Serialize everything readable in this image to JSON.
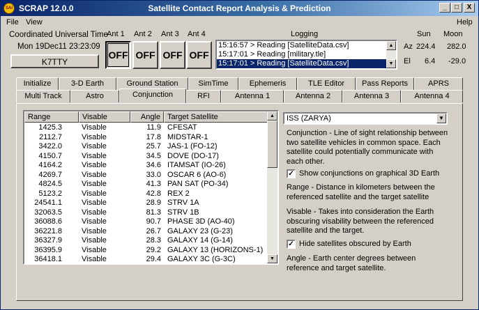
{
  "window": {
    "app_name": "SCRAP  12.0.0",
    "title": "Satellite Contact Report Analysis & Prediction",
    "logo_text": "SAI",
    "minimize": "_",
    "maximize": "□",
    "close": "X"
  },
  "menu": {
    "file": "File",
    "view": "View",
    "help": "Help"
  },
  "clock": {
    "label": "Coordinated Universal Time",
    "value": "Mon 19Dec11 23:23:09",
    "callsign": "K7TTY"
  },
  "antennas": [
    {
      "label": "Ant 1",
      "state": "OFF"
    },
    {
      "label": "Ant 2",
      "state": "OFF"
    },
    {
      "label": "Ant 3",
      "state": "OFF"
    },
    {
      "label": "Ant 4",
      "state": "OFF"
    }
  ],
  "logging": {
    "label": "Logging",
    "lines": [
      "15:16:57 > Reading [SatelliteData.csv]",
      "15:17:01 > Reading [military.tle]",
      "15:17:01 > Reading [SatelliteData.csv]"
    ]
  },
  "sunmoon": {
    "sun_label": "Sun",
    "moon_label": "Moon",
    "az_label": "Az",
    "el_label": "El",
    "sun_az": "224.4",
    "moon_az": "282.0",
    "sun_el": "6.4",
    "moon_el": "-29.0"
  },
  "tabs_row1": [
    "Initialize",
    "3-D Earth",
    "Ground Station",
    "SimTime",
    "Ephemeris",
    "TLE Editor",
    "Pass Reports",
    "APRS"
  ],
  "tabs_row2": [
    "Multi Track",
    "Astro",
    "Conjunction",
    "RFI",
    "Antenna 1",
    "Antenna 2",
    "Antenna 3",
    "Antenna 4"
  ],
  "table": {
    "headers": [
      "Range",
      "Visable",
      "Angle",
      "Target Satellite"
    ],
    "rows": [
      [
        "1425.3",
        "Visable",
        "11.9",
        "CFESAT"
      ],
      [
        "2112.7",
        "Visable",
        "17.8",
        "MIDSTAR-1"
      ],
      [
        "3422.0",
        "Visable",
        "25.7",
        "JAS-1 (FO-12)"
      ],
      [
        "4150.7",
        "Visable",
        "34.5",
        "DOVE (DO-17)"
      ],
      [
        "4164.2",
        "Visable",
        "34.6",
        "ITAMSAT (IO-26)"
      ],
      [
        "4269.7",
        "Visable",
        "33.0",
        "OSCAR 6 (AO-6)"
      ],
      [
        "4824.5",
        "Visable",
        "41.3",
        "PAN SAT (PO-34)"
      ],
      [
        "5123.2",
        "Visable",
        "42.8",
        "REX 2"
      ],
      [
        "24541.1",
        "Visable",
        "28.9",
        "STRV 1A"
      ],
      [
        "32063.5",
        "Visable",
        "81.3",
        "STRV 1B"
      ],
      [
        "36088.6",
        "Visable",
        "90.7",
        "PHASE 3D (AO-40)"
      ],
      [
        "36221.8",
        "Visable",
        "26.7",
        "GALAXY 23 (G-23)"
      ],
      [
        "36327.9",
        "Visable",
        "28.3",
        "GALAXY 14 (G-14)"
      ],
      [
        "36395.9",
        "Visable",
        "29.2",
        "GALAXY 13 (HORIZONS-1)"
      ],
      [
        "36418.1",
        "Visable",
        "29.4",
        "GALAXY 3C (G-3C)"
      ]
    ]
  },
  "conjunction": {
    "selected_satellite": "ISS (ZARYA)",
    "desc_conjunction": "Conjunction - Line of sight relationship between two satellite vehicles in common space.  Each satellite could potentially communicate with each other.",
    "chk_show_label": "Show conjunctions on graphical 3D Earth",
    "chk_show_checked": true,
    "desc_range": "Range - Distance in kilometers between the referenced satellite and the target satellite",
    "desc_visable": "Visable - Takes into consideration the Earth obscuring visability between the referenced satellite and the target.",
    "chk_hide_label": "Hide satellites obscured by Earth",
    "chk_hide_checked": true,
    "desc_angle": "Angle - Earth center degrees between reference and target satellite."
  }
}
